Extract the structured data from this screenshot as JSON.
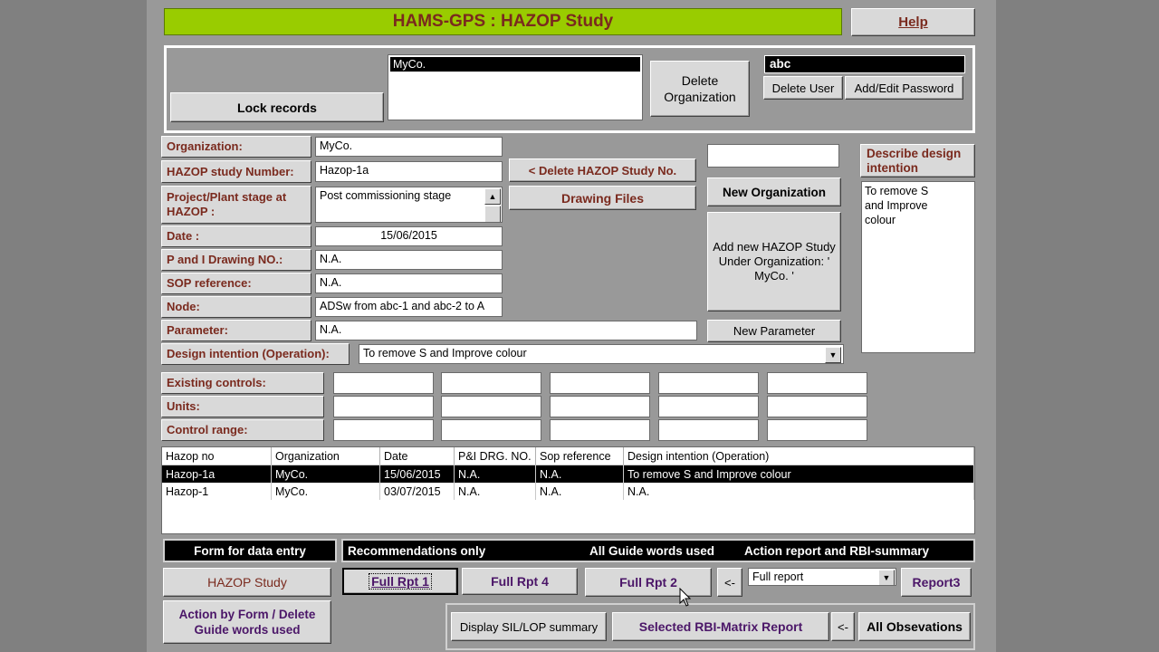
{
  "title": "HAMS-GPS : HAZOP Study",
  "help_label": "Help",
  "top_panel": {
    "lock_records": "Lock records",
    "org_list": [
      "MyCo."
    ],
    "delete_organization": "Delete Organization",
    "user_value": "abc",
    "delete_user": "Delete User",
    "add_edit_password": "Add/Edit Password"
  },
  "form": {
    "organization_label": "Organization:",
    "organization_value": "MyCo.",
    "study_number_label": "HAZOP study Number:",
    "study_number_value": "Hazop-1a",
    "stage_label": "Project/Plant stage at HAZOP :",
    "stage_value": "Post commissioning stage",
    "date_label": "Date :",
    "date_value": "15/06/2015",
    "pid_label": "P and I Drawing NO.:",
    "pid_value": "N.A.",
    "sop_label": "SOP reference:",
    "sop_value": "N.A.",
    "node_label": "Node:",
    "node_value": "ADSw  from abc-1 and abc-2 to A",
    "parameter_label": "Parameter:",
    "parameter_value": "N.A.",
    "design_intention_label": "Design intention (Operation):",
    "design_intention_value": "To remove S and Improve colour",
    "existing_controls_label": "Existing controls:",
    "units_label": "Units:",
    "control_range_label": "Control range:"
  },
  "mid_buttons": {
    "delete_study": "< Delete HAZOP Study No.",
    "drawing_files": "Drawing Files",
    "new_organization": "New Organization",
    "add_new_study": "Add new HAZOP Study Under Organization: ' MyCo. '",
    "new_parameter": "New Parameter"
  },
  "describe": {
    "button": "Describe design intention",
    "text": "To remove S and Improve colour"
  },
  "grid": {
    "columns": [
      "Hazop no",
      "Organization",
      "Date",
      "P&I DRG. NO.",
      "Sop reference",
      "Design intention (Operation)"
    ],
    "rows": [
      [
        "Hazop-1a",
        "MyCo.",
        "15/06/2015",
        "N.A.",
        "N.A.",
        "To remove S and Improve colour"
      ],
      [
        "Hazop-1",
        "MyCo.",
        "03/07/2015",
        "N.A.",
        "N.A.",
        "N.A."
      ]
    ]
  },
  "bottom": {
    "form_entry": "Form for data entry",
    "recommendations": "Recommendations only",
    "all_guide_words": "All Guide words used",
    "action_report": "Action report and RBI-summary",
    "hazop_study": "HAZOP Study",
    "full_rpt1": "Full Rpt 1",
    "full_rpt4": "Full Rpt 4",
    "full_rpt2": "Full Rpt 2",
    "arrow1": "<-",
    "report_select": "Full report",
    "report3": "Report3",
    "action_by_form": "Action by Form / Delete Guide words used",
    "display_sil": "Display SIL/LOP summary",
    "selected_rbi": "Selected RBI-Matrix Report",
    "arrow2": "<-",
    "all_observations": "All Obsevations"
  }
}
